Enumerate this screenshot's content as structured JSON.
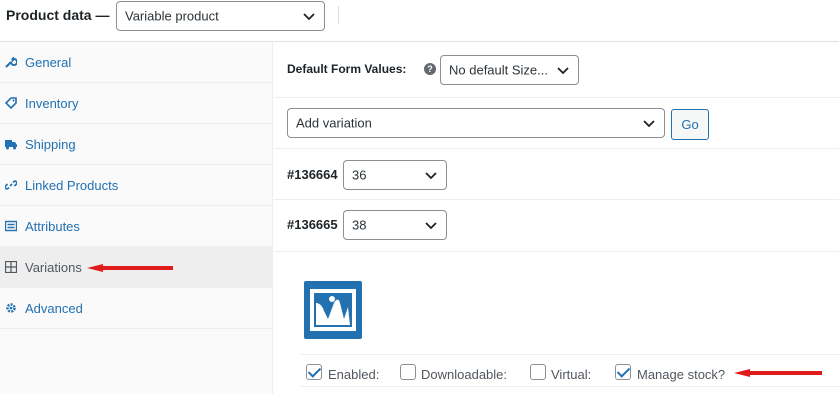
{
  "header": {
    "title": "Product data —",
    "product_type": "Variable product"
  },
  "sidebar": {
    "items": [
      {
        "label": "General",
        "icon": "wrench-icon"
      },
      {
        "label": "Inventory",
        "icon": "tag-icon"
      },
      {
        "label": "Shipping",
        "icon": "truck-icon"
      },
      {
        "label": "Linked Products",
        "icon": "link-icon"
      },
      {
        "label": "Attributes",
        "icon": "list-icon"
      },
      {
        "label": "Variations",
        "icon": "grid-icon",
        "active": true
      },
      {
        "label": "Advanced",
        "icon": "gear-icon"
      }
    ]
  },
  "main": {
    "default_form_values_label": "Default Form Values:",
    "default_form_select": "No default Size...",
    "add_variation_select": "Add variation",
    "go_button": "Go",
    "variations": [
      {
        "id": "#136664",
        "size": "36"
      },
      {
        "id": "#136665",
        "size": "38"
      }
    ],
    "checkboxes": [
      {
        "label": "Enabled:",
        "checked": true
      },
      {
        "label": "Downloadable:",
        "checked": false
      },
      {
        "label": "Virtual:",
        "checked": false
      },
      {
        "label": "Manage stock?",
        "checked": true
      }
    ]
  },
  "colors": {
    "accent": "#2271b1",
    "annotation_arrow": "#e01b1b"
  }
}
